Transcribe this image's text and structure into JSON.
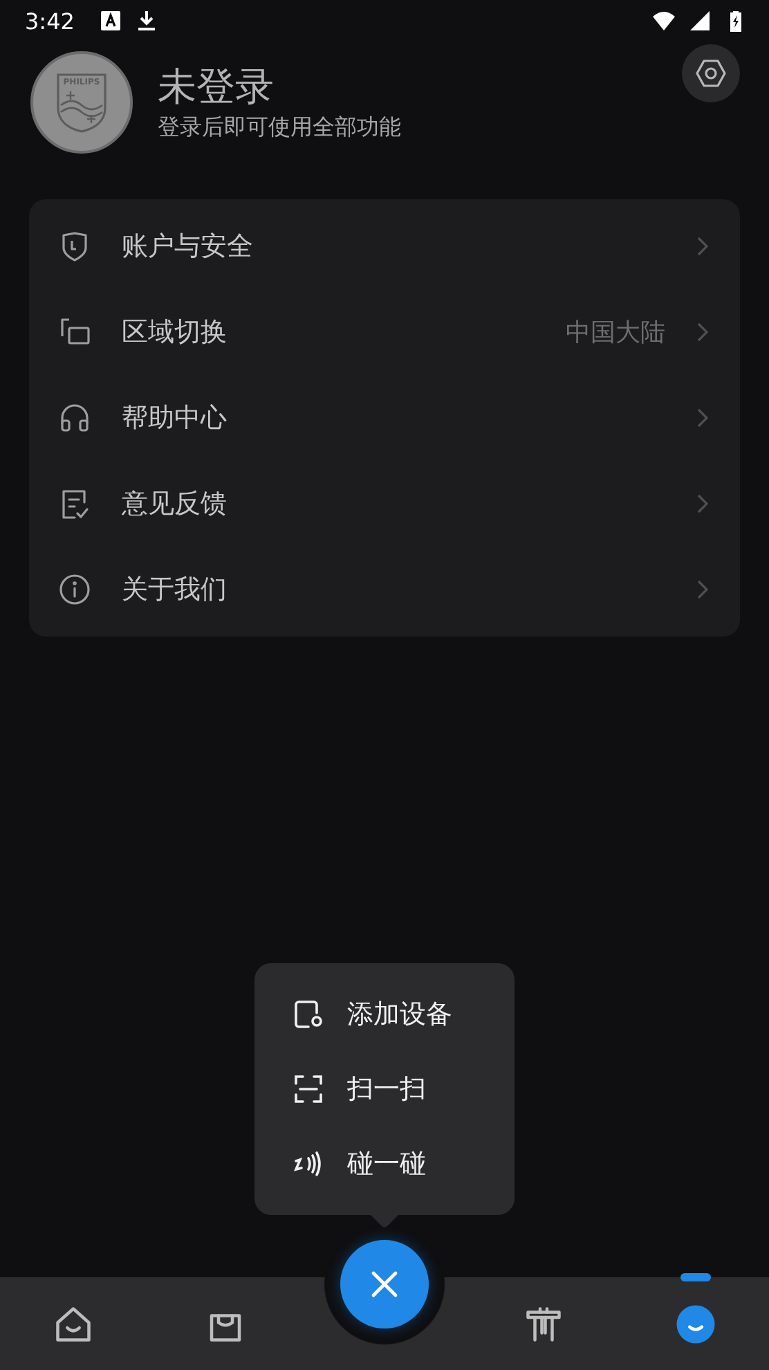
{
  "status_bar": {
    "time": "3:42"
  },
  "profile": {
    "logo_text": "PHILIPS",
    "title": "未登录",
    "subtitle": "登录后即可使用全部功能"
  },
  "menu": [
    {
      "label": "账户与安全"
    },
    {
      "label": "区域切换",
      "value": "中国大陆"
    },
    {
      "label": "帮助中心"
    },
    {
      "label": "意见反馈"
    },
    {
      "label": "关于我们"
    }
  ],
  "popup": {
    "items": [
      {
        "label": "添加设备"
      },
      {
        "label": "扫一扫"
      },
      {
        "label": "碰一碰"
      }
    ]
  },
  "nav": {
    "tabs": [
      {
        "selected": false
      },
      {
        "selected": false
      },
      {
        "selected": false
      },
      {
        "selected": true
      }
    ]
  }
}
